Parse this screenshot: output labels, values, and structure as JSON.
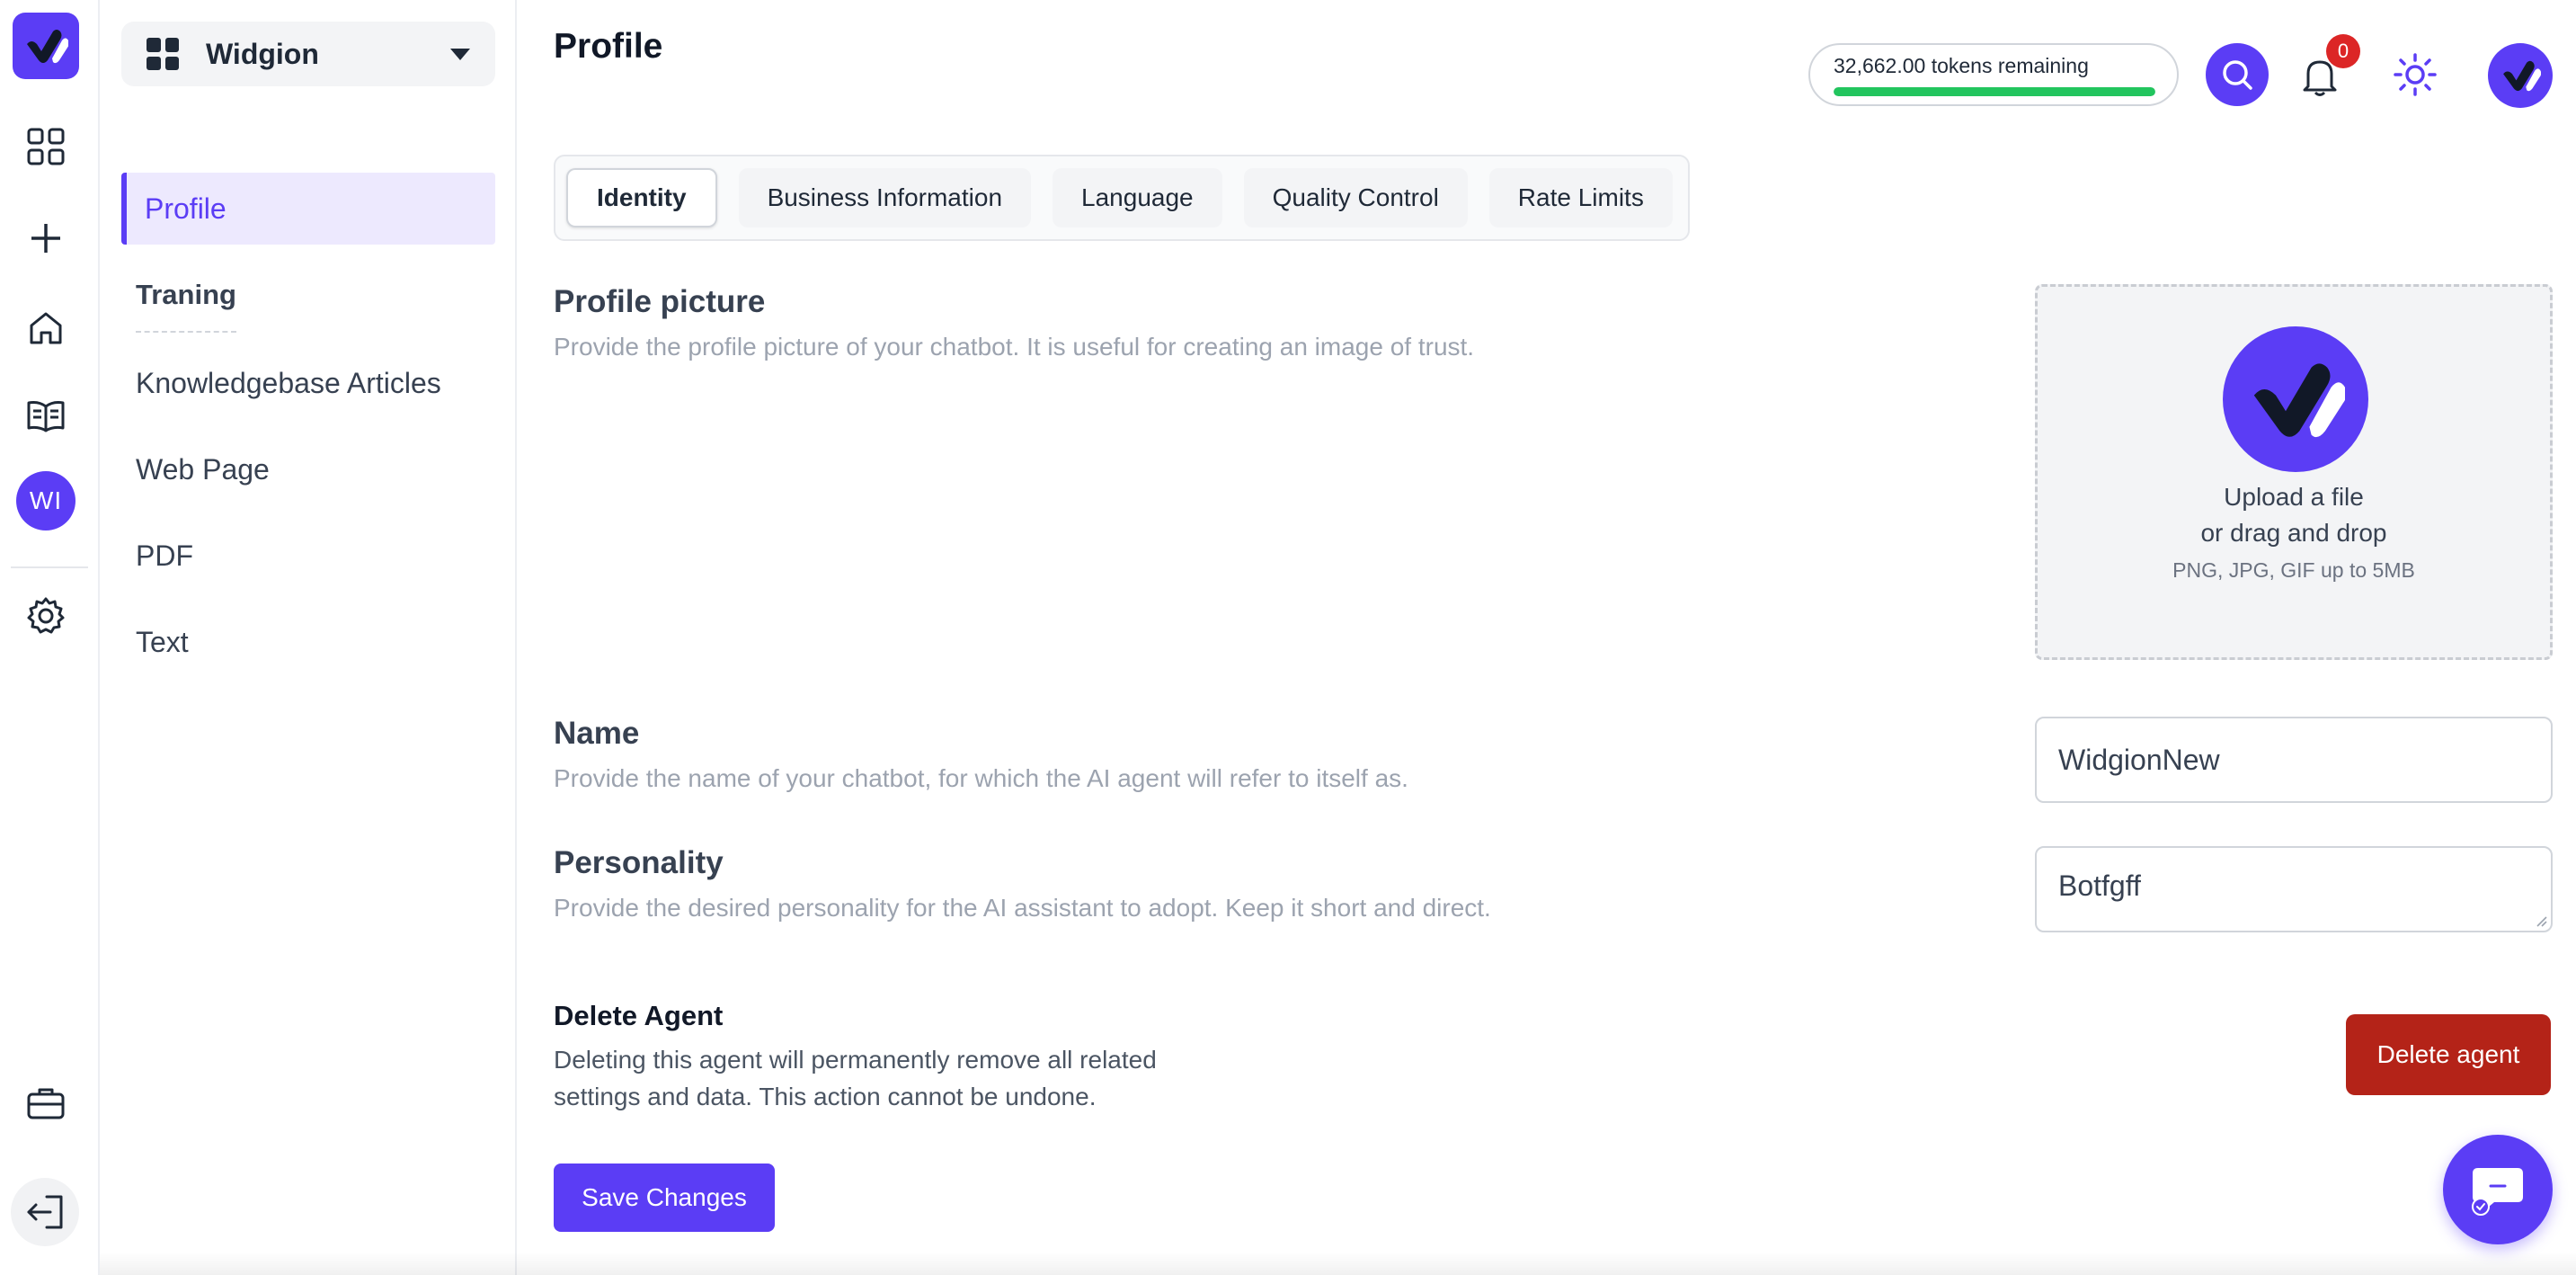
{
  "app": {
    "workspace_name": "Widgion",
    "rail_avatar_initials": "WI",
    "accent_color": "#5b3df5",
    "danger_color": "#b42318",
    "success_color": "#22c55e"
  },
  "rail": {
    "icons": [
      "logo-icon",
      "dashboard-grid-icon",
      "plus-icon",
      "home-icon",
      "book-icon",
      "workspace-avatar",
      "gear-icon",
      "briefcase-icon",
      "logout-icon"
    ]
  },
  "sidebar": {
    "items": [
      {
        "label": "Profile",
        "active": true
      },
      {
        "label": "Traning"
      },
      {
        "label": "Knowledgebase Articles"
      },
      {
        "label": "Web Page"
      },
      {
        "label": "PDF"
      },
      {
        "label": "Text"
      }
    ]
  },
  "header": {
    "title": "Profile",
    "tokens_text": "32,662.00 tokens remaining",
    "tokens_fraction": 1.0,
    "notification_count": "0"
  },
  "tabs": [
    {
      "label": "Identity",
      "active": true
    },
    {
      "label": "Business Information"
    },
    {
      "label": "Language"
    },
    {
      "label": "Quality Control"
    },
    {
      "label": "Rate Limits"
    }
  ],
  "profile_picture": {
    "title": "Profile picture",
    "description": "Provide the profile picture of your chatbot. It is useful for creating an image of trust.",
    "upload_line1": "Upload a file",
    "upload_line2": "or drag and drop",
    "upload_note": "PNG, JPG, GIF up to 5MB"
  },
  "name_field": {
    "title": "Name",
    "description": "Provide the name of your chatbot, for which the AI agent will refer to itself as.",
    "value": "WidgionNew"
  },
  "personality_field": {
    "title": "Personality",
    "description": "Provide the desired personality for the AI assistant to adopt. Keep it short and direct.",
    "value": "Botfgff"
  },
  "delete_agent": {
    "title": "Delete Agent",
    "description": "Deleting this agent will permanently remove all related settings and data. This action cannot be undone.",
    "button_label": "Delete agent"
  },
  "save_button_label": "Save Changes"
}
